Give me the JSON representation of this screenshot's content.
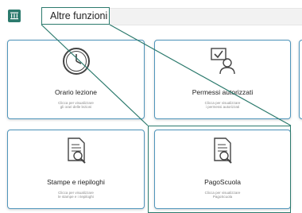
{
  "callout": {
    "label": "Altre funzioni"
  },
  "cards": [
    {
      "title": "Orario lezione",
      "sub1": "Clicca per visualizzare",
      "sub2": "gli orari delle lezioni"
    },
    {
      "title": "Permessi autorizzati",
      "sub1": "Clicca per visualizzare",
      "sub2": "i permessi autorizzati"
    },
    {
      "title": "Stampe e riepiloghi",
      "sub1": "Clicca per visualizzare",
      "sub2": "le stampe e i riepiloghi"
    },
    {
      "title": "PagoScuola",
      "sub1": "Clicca per visualizzare",
      "sub2": "PagoScuola"
    }
  ],
  "colors": {
    "accent": "#2c7a6d",
    "card_border": "#4f95bb"
  }
}
